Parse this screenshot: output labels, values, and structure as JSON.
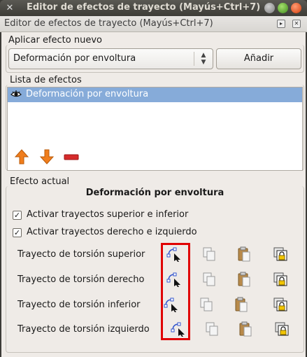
{
  "window": {
    "title": "Editor de efectos de trayecto (Mayús+Ctrl+7)"
  },
  "dock": {
    "title": "Editor de efectos de trayecto (Mayús+Ctrl+7)"
  },
  "apply": {
    "group_label": "Aplicar efecto nuevo",
    "selected": "Deformación por envoltura",
    "add_label": "Añadir"
  },
  "effects": {
    "group_label": "Lista de efectos",
    "items": [
      {
        "label": "Deformación por envoltura",
        "visible": true
      }
    ]
  },
  "current": {
    "group_label": "Efecto actual",
    "title": "Deformación por envoltura",
    "checks": [
      {
        "label": "Activar trayectos superior e inferior",
        "checked": true
      },
      {
        "label": "Activar trayectos derecho e izquierdo",
        "checked": true
      }
    ],
    "paths": [
      {
        "label": "Trayecto de torsión superior"
      },
      {
        "label": "Trayecto de torsión derecho"
      },
      {
        "label": "Trayecto de torsión inferior"
      },
      {
        "label": "Trayecto de torsión izquierdo"
      }
    ]
  },
  "colors": {
    "highlight": "#e00000",
    "selection": "#86abd9",
    "arrow": "#f07d1c",
    "remove": "#d62b2b"
  }
}
